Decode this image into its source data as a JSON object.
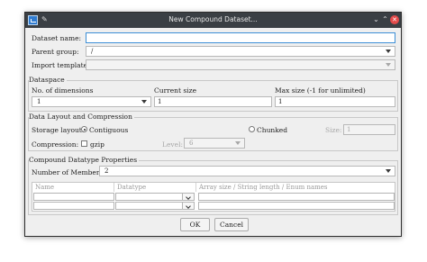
{
  "window": {
    "title": "New Compound Dataset..."
  },
  "form": {
    "dataset_name_label": "Dataset name:",
    "dataset_name_value": "",
    "parent_group_label": "Parent group:",
    "parent_group_value": "/",
    "import_template_label": "Import template:",
    "import_template_value": ""
  },
  "dataspace": {
    "title": "Dataspace",
    "dims_label": "No. of dimensions",
    "dims_value": "1",
    "current_size_label": "Current size",
    "current_size_value": "1",
    "max_size_label": "Max size (-1 for unlimited)",
    "max_size_value": "1"
  },
  "layout": {
    "title": "Data Layout and Compression",
    "storage_label": "Storage layout:",
    "contiguous_label": "Contiguous",
    "chunked_label": "Chunked",
    "size_label": "Size:",
    "size_value": "1",
    "compression_label": "Compression:",
    "gzip_label": "gzip",
    "level_label": "Level:",
    "level_value": "6"
  },
  "compound": {
    "title": "Compound Datatype Properties",
    "members_label": "Number of Members:",
    "members_value": "2",
    "columns": [
      "Name",
      "Datatype",
      "Array size / String length / Enum names"
    ]
  },
  "buttons": {
    "ok": "OK",
    "cancel": "Cancel"
  }
}
